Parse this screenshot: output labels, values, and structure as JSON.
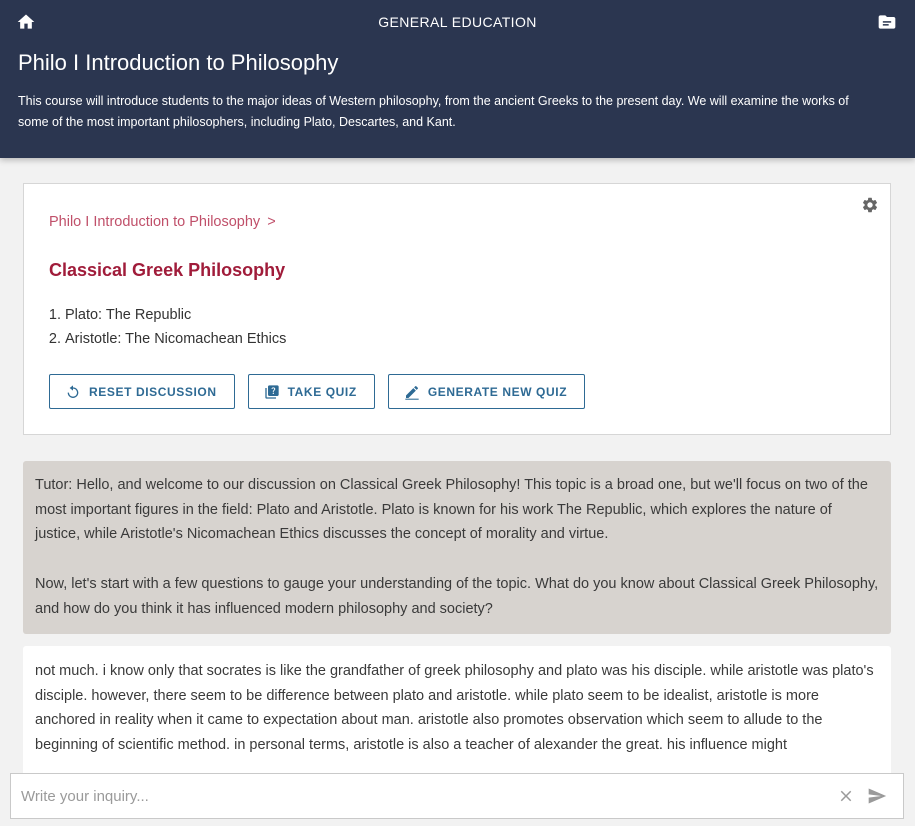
{
  "header": {
    "top_title": "GENERAL EDUCATION",
    "course_title": "Philo I Introduction to Philosophy",
    "course_description": "This course will introduce students to the major ideas of Western philosophy, from the ancient Greeks to the present day. We will examine the works of some of the most important philosophers, including Plato, Descartes, and Kant.",
    "icons": {
      "home": "home-icon",
      "folder": "folder-icon"
    }
  },
  "card": {
    "breadcrumb": "Philo I Introduction to Philosophy",
    "breadcrumb_separator": ">",
    "topic_title": "Classical Greek Philosophy",
    "readings": [
      "Plato: The Republic",
      "Aristotle: The Nicomachean Ethics"
    ],
    "buttons": {
      "reset": "RESET DISCUSSION",
      "quiz": "TAKE QUIZ",
      "generate": "GENERATE NEW QUIZ"
    },
    "accent_color": "#a01c3a",
    "button_color": "#2e6a94"
  },
  "messages": {
    "tutor_p1": "Tutor: Hello, and welcome to our discussion on Classical Greek Philosophy! This topic is a broad one, but we'll focus on two of the most important figures in the field: Plato and Aristotle. Plato is known for his work The Republic, which explores the nature of justice, while Aristotle's Nicomachean Ethics discusses the concept of morality and virtue.",
    "tutor_p2": "Now, let's start with a few questions to gauge your understanding of the topic. What do you know about Classical Greek Philosophy, and how do you think it has influenced modern philosophy and society?",
    "user": "not much. i know only that socrates is like the grandfather of greek philosophy and plato was his disciple. while aristotle was plato's disciple. however, there seem to be difference between plato and aristotle. while plato seem to be idealist, aristotle is more anchored in reality when it came to expectation about man. aristotle also promotes observation which seem to allude to the beginning of scientific method. in personal terms, aristotle is also a teacher of alexander the great. his influence might"
  },
  "input": {
    "placeholder": "Write your inquiry..."
  }
}
